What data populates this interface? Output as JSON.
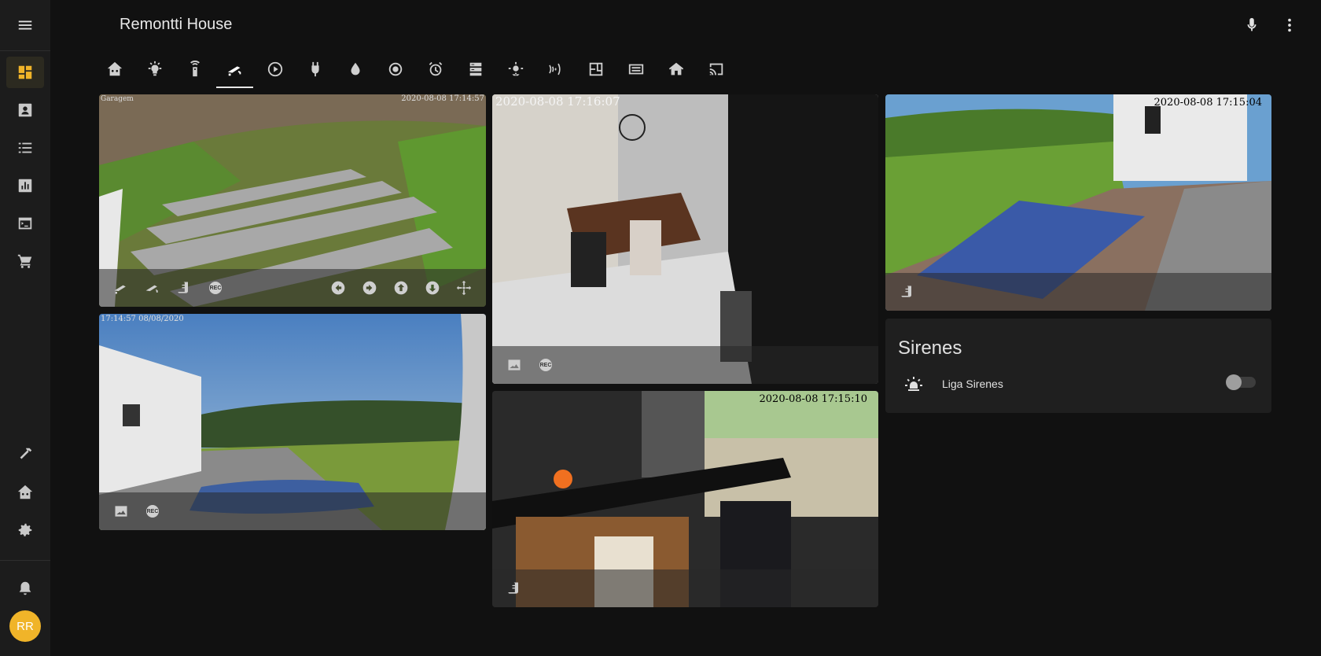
{
  "app": {
    "title": "Remontti House",
    "user_initials": "RR"
  },
  "tabs": [
    {
      "name": "home-tab",
      "icon": "home-assistant-icon"
    },
    {
      "name": "lights-tab",
      "icon": "lightbulb-icon"
    },
    {
      "name": "remote-tab",
      "icon": "remote-icon"
    },
    {
      "name": "cameras-tab",
      "icon": "cctv-icon",
      "active": true
    },
    {
      "name": "media-tab",
      "icon": "play-circle-icon"
    },
    {
      "name": "power-tab",
      "icon": "power-plug-icon"
    },
    {
      "name": "water-tab",
      "icon": "water-icon"
    },
    {
      "name": "network-tab",
      "icon": "network-icon"
    },
    {
      "name": "automation-tab",
      "icon": "alarm-icon"
    },
    {
      "name": "logs-tab",
      "icon": "server-icon"
    },
    {
      "name": "weather-tab",
      "icon": "weather-icon"
    },
    {
      "name": "wifi-tab",
      "icon": "wifi-icon"
    },
    {
      "name": "floorplan-tab",
      "icon": "floor-plan-icon"
    },
    {
      "name": "devices-tab",
      "icon": "devices-icon"
    },
    {
      "name": "house-tab",
      "icon": "house-icon"
    },
    {
      "name": "cast-tab",
      "icon": "cast-icon"
    }
  ],
  "cameras": {
    "garagem": {
      "label": "Garagem",
      "timestamp": "2020-08-08 17:14:57"
    },
    "sala": {
      "timestamp": "2020-08-08 17:16:07"
    },
    "piscina": {
      "timestamp": "2020-08-08 17:15:04"
    },
    "frente": {
      "timestamp": "17:14:57 08/08/2020"
    },
    "cozinha": {
      "timestamp": "2020-08-08 17:15:10"
    }
  },
  "sirenes": {
    "title": "Sirenes",
    "entity_name": "Liga Sirenes",
    "state": "off"
  },
  "colors": {
    "accent": "#f0b429",
    "background": "#111111",
    "sidebar": "#1c1c1c",
    "card": "#1f1f1f"
  }
}
